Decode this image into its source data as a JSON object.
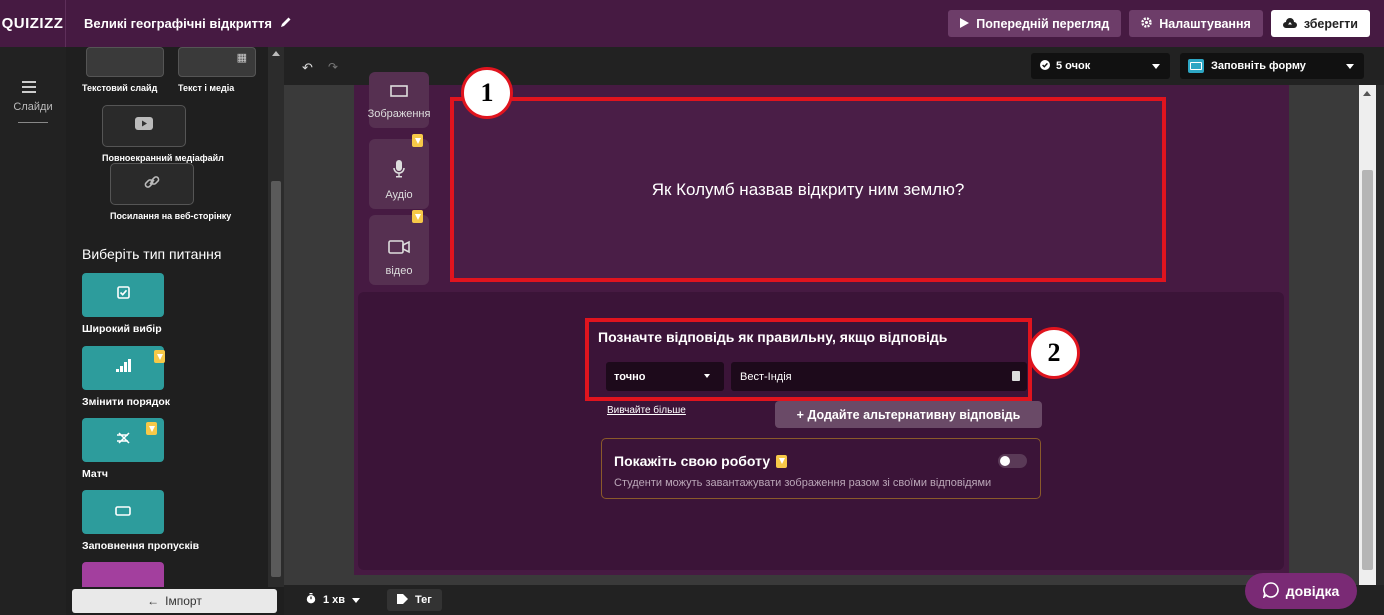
{
  "topbar": {
    "logo": "QUIZIZZ",
    "quiz_title": "Великі географічні відкриття",
    "preview_label": "Попередній перегляд",
    "settings_label": "Налаштування",
    "save_label": "зберегти"
  },
  "rail": {
    "slides_label": "Слайди"
  },
  "panel": {
    "slide_types": {
      "text_slide": "Текстовий слайд",
      "text_media": "Текст і медіа",
      "fullscreen_media": "Повноекранний медіафайл",
      "web_link": "Посилання на веб-сторінку"
    },
    "question_heading": "Виберіть тип питання",
    "question_types": [
      {
        "label": "Широкий вибір",
        "premium": false
      },
      {
        "label": "Змінити порядок",
        "premium": true
      },
      {
        "label": "Матч",
        "premium": true
      },
      {
        "label": "Заповнення пропусків",
        "premium": false
      }
    ],
    "import_label": "Імпорт"
  },
  "toolbar": {
    "points": "5 очок",
    "question_type": "Заповніть форму"
  },
  "editor": {
    "media_buttons": [
      {
        "label": "Зображення"
      },
      {
        "label": "Аудіо"
      },
      {
        "label": "відео"
      }
    ],
    "question_text": "Як Колумб назвав відкриту ним землю?",
    "answer_heading": "Позначте відповідь як правильну, якщо відповідь",
    "match_mode": "точно",
    "answer_value": "Вест-Індія",
    "learn_more": "Вивчайте більше",
    "add_alt_answer": "+ Додайте альтернативну відповідь",
    "show_work_title": "Покажіть свою роботу",
    "show_work_desc": "Студенти можуть завантажувати зображення разом зі своїми відповідями",
    "show_work_enabled": false
  },
  "callouts": {
    "one": "1",
    "two": "2"
  },
  "bottombar": {
    "timer": "1 хв",
    "tag": "Тег",
    "help": "довідка"
  },
  "colors": {
    "brand": "#461a42",
    "accent_teal": "#2d9c9c",
    "highlight_red": "#e0141e"
  }
}
